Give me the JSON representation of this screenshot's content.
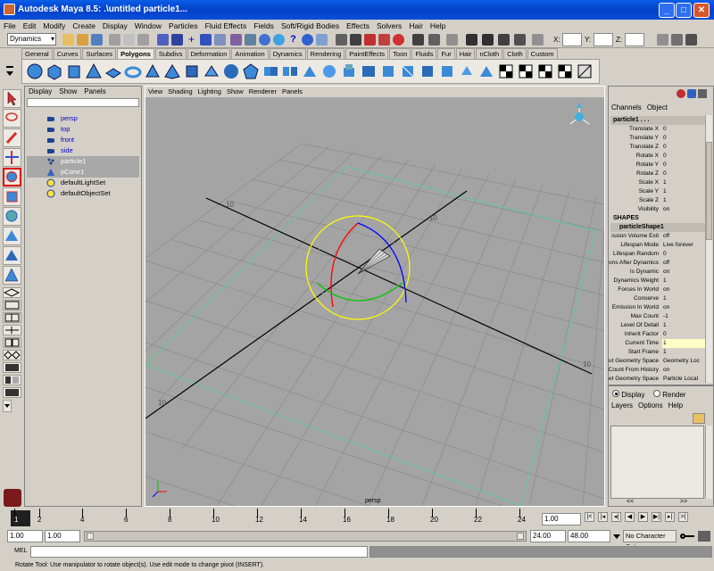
{
  "window": {
    "title": "Autodesk Maya 8.5: .\\untitled    particle1...",
    "min": "_",
    "max": "□",
    "close": "✕"
  },
  "menubar": [
    "File",
    "Edit",
    "Modify",
    "Create",
    "Display",
    "Window",
    "Particles",
    "Fluid Effects",
    "Fields",
    "Soft/Rigid Bodies",
    "Effects",
    "Solvers",
    "Hair",
    "Help"
  ],
  "statusline": {
    "menu_set": "Dynamics",
    "x_label": "X:",
    "y_label": "Y:",
    "z_label": "Z:"
  },
  "shelf_tabs": [
    "General",
    "Curves",
    "Surfaces",
    "Polygons",
    "Subdivs",
    "Deformation",
    "Animation",
    "Dynamics",
    "Rendering",
    "PaintEffects",
    "Toon",
    "Fluids",
    "Fur",
    "Hair",
    "nCloth",
    "Cloth",
    "Custom"
  ],
  "shelf_active": "Polygons",
  "outliner": {
    "menu": [
      "Display",
      "Show",
      "Panels"
    ],
    "items": [
      {
        "label": "persp",
        "style": "blue",
        "icon": "camera-icon"
      },
      {
        "label": "top",
        "style": "blue",
        "icon": "camera-icon"
      },
      {
        "label": "front",
        "style": "blue",
        "icon": "camera-icon"
      },
      {
        "label": "side",
        "style": "blue",
        "icon": "camera-icon"
      },
      {
        "label": "particle1",
        "style": "selected",
        "icon": "particle-icon"
      },
      {
        "label": "pCone1",
        "style": "selected",
        "icon": "cone-icon"
      },
      {
        "label": "defaultLightSet",
        "style": "normal",
        "icon": "set-icon"
      },
      {
        "label": "defaultObjectSet",
        "style": "normal",
        "icon": "set-icon"
      }
    ]
  },
  "viewport": {
    "menu": [
      "View",
      "Shading",
      "Lighting",
      "Show",
      "Renderer",
      "Panels"
    ],
    "camera_label": "persp",
    "grid_labels": [
      "10",
      "10",
      "10",
      "10"
    ],
    "accent_colors": {
      "x": "#ff0000",
      "y": "#00c800",
      "z": "#0000ff",
      "manipulator": "#ffff00"
    }
  },
  "channel_box": {
    "menu": [
      "Channels",
      "Object"
    ],
    "object_name": "particle1 . . .",
    "transform": [
      {
        "name": "Translate X",
        "value": "0"
      },
      {
        "name": "Translate Y",
        "value": "0"
      },
      {
        "name": "Translate Z",
        "value": "0"
      },
      {
        "name": "Rotate X",
        "value": "0"
      },
      {
        "name": "Rotate Y",
        "value": "0"
      },
      {
        "name": "Rotate Z",
        "value": "0"
      },
      {
        "name": "Scale X",
        "value": "1"
      },
      {
        "name": "Scale Y",
        "value": "1"
      },
      {
        "name": "Scale Z",
        "value": "1"
      },
      {
        "name": "Visibility",
        "value": "on"
      }
    ],
    "shapes_label": "SHAPES",
    "shape_name": "particleShape1",
    "shape_attrs": [
      {
        "name": "ission Volume Exit",
        "value": "off"
      },
      {
        "name": "Lifespan Mode",
        "value": "Live forever"
      },
      {
        "name": "Lifespan Random",
        "value": "0"
      },
      {
        "name": "ons After Dynamics",
        "value": "off"
      },
      {
        "name": "Is Dynamic",
        "value": "on"
      },
      {
        "name": "Dynamics Weight",
        "value": "1"
      },
      {
        "name": "Forces In World",
        "value": "on"
      },
      {
        "name": "Conserve",
        "value": "1"
      },
      {
        "name": "Emission In World",
        "value": "on"
      },
      {
        "name": "Max Count",
        "value": "-1"
      },
      {
        "name": "Level Of Detail",
        "value": "1"
      },
      {
        "name": "Inherit Factor",
        "value": "0"
      },
      {
        "name": "Current Time",
        "value": "1",
        "highlight": true
      },
      {
        "name": "Start Frame",
        "value": "1"
      },
      {
        "name": "ut Geometry Space",
        "value": "Geometry Loc"
      },
      {
        "name": "Count From History",
        "value": "on"
      },
      {
        "name": "et Geometry Space",
        "value": "Particle Local"
      }
    ]
  },
  "layer_panel": {
    "display_label": "Display",
    "render_label": "Render",
    "menu": [
      "Layers",
      "Options",
      "Help"
    ],
    "nav_left": "<<",
    "nav_right": ">>"
  },
  "time_slider": {
    "ticks": [
      "1",
      "2",
      "4",
      "6",
      "8",
      "10",
      "12",
      "14",
      "16",
      "18",
      "20",
      "22",
      "24"
    ],
    "current_frame": "1.00",
    "playback_buttons": [
      "|<",
      "|◂",
      "◂|",
      "◀",
      "▶",
      "▶|",
      "▸|",
      ">|"
    ]
  },
  "range_slider": {
    "start": "1.00",
    "start2": "1.00",
    "end": "24.00",
    "end2": "48.00",
    "character_set": "No Character Set"
  },
  "command_line": {
    "label": "MEL"
  },
  "help_line": "Rotate Tool: Use manipulator to rotate object(s). Use edit mode to change pivot (INSERT)."
}
